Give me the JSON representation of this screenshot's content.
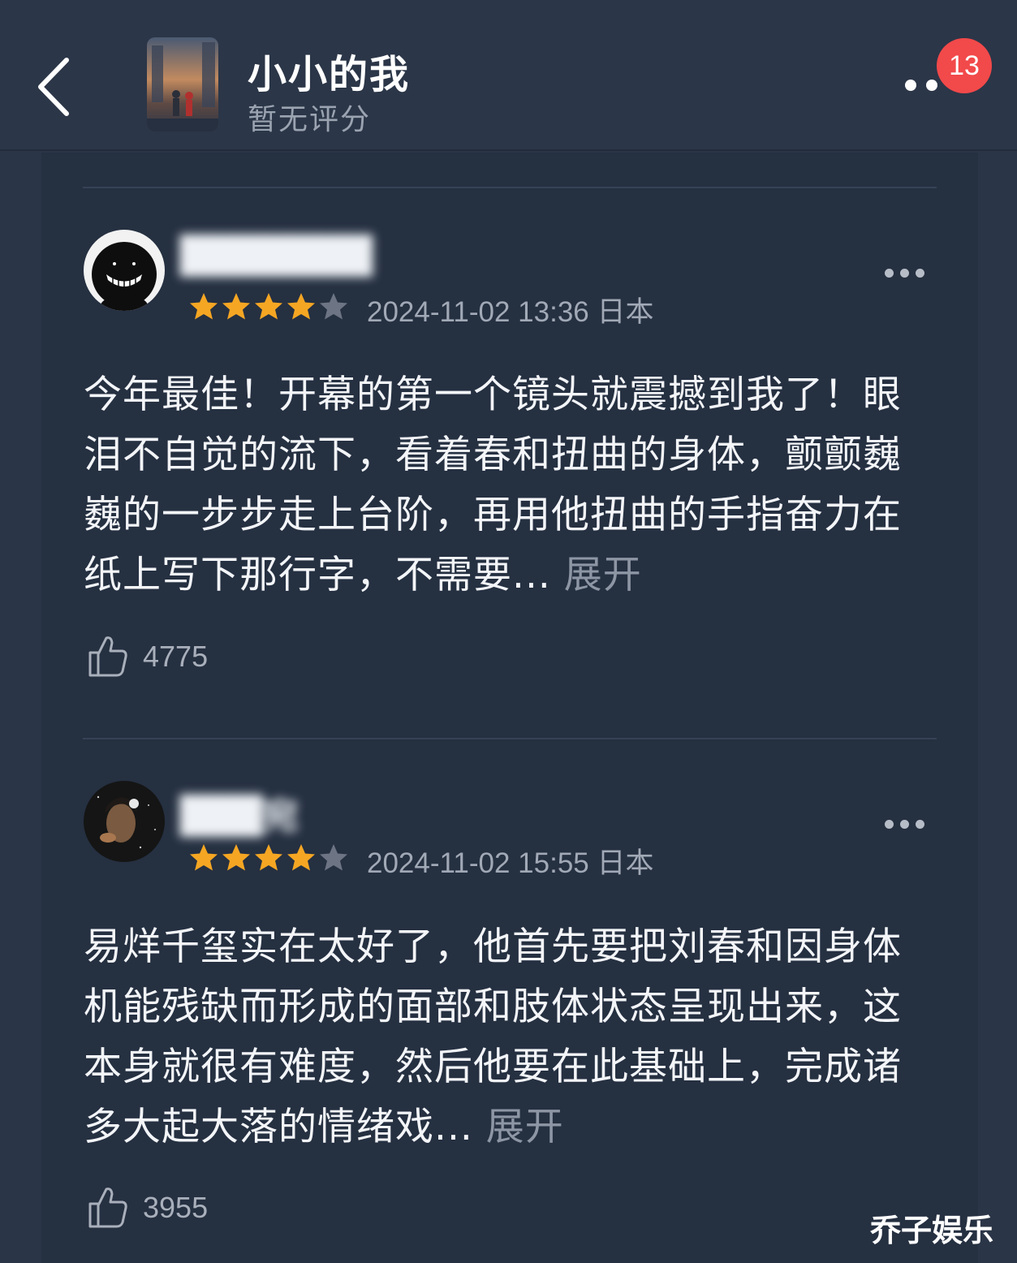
{
  "header": {
    "title": "小小的我",
    "rating": "暂无评分",
    "notification_count": "13"
  },
  "reviews": [
    {
      "username": "███████",
      "stars": 4,
      "date": "2024-11-02 13:36",
      "region": "日本",
      "text": "今年最佳！开幕的第一个镜头就震撼到我了！眼泪不自觉的流下，看着春和扭曲的身体，颤颤巍巍的一步步走上台阶，再用他扭曲的手指奋力在纸上写下那行字，不需要...",
      "expand_label": "展开",
      "likes": "4775"
    },
    {
      "username": "███宛",
      "stars": 4,
      "date": "2024-11-02 15:55",
      "region": "日本",
      "text": "易烊千玺实在太好了，他首先要把刘春和因身体机能残缺而形成的面部和肢体状态呈现出来，这本身就很有难度，然后他要在此基础上，完成诸多大起大落的情绪戏...",
      "expand_label": "展开",
      "likes": "3955"
    }
  ],
  "watermark": "乔子娱乐",
  "colors": {
    "background": "#2a3547",
    "panel": "#253041",
    "star": "#f5a623",
    "badge": "#f2494a"
  }
}
